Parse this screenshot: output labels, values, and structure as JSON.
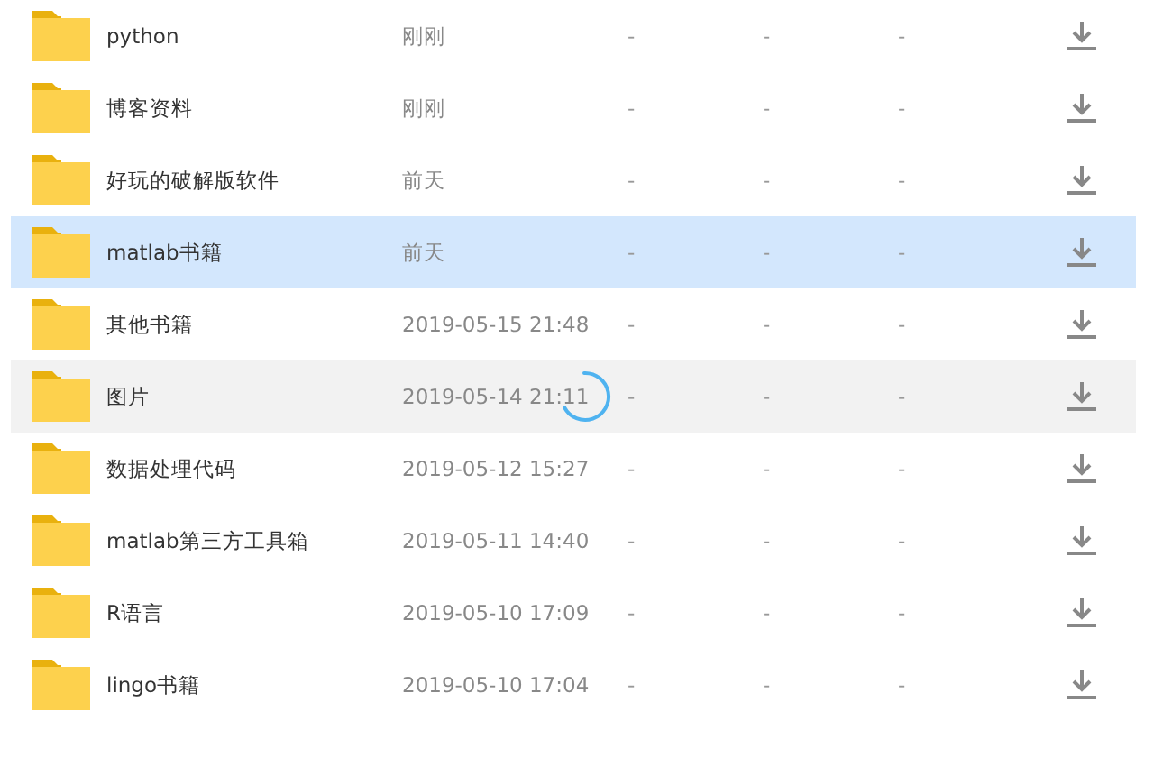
{
  "files": [
    {
      "name": "python",
      "time": "刚刚",
      "column_3": "-",
      "column_4": "-",
      "column_5": "-",
      "selected": false,
      "hovered": false,
      "loading": false
    },
    {
      "name": "博客资料",
      "time": "刚刚",
      "column_3": "-",
      "column_4": "-",
      "column_5": "-",
      "selected": false,
      "hovered": false,
      "loading": false
    },
    {
      "name": "好玩的破解版软件",
      "time": "前天",
      "column_3": "-",
      "column_4": "-",
      "column_5": "-",
      "selected": false,
      "hovered": false,
      "loading": false
    },
    {
      "name": "matlab书籍",
      "time": "前天",
      "column_3": "-",
      "column_4": "-",
      "column_5": "-",
      "selected": true,
      "hovered": false,
      "loading": false
    },
    {
      "name": "其他书籍",
      "time": "2019-05-15 21:48",
      "column_3": "-",
      "column_4": "-",
      "column_5": "-",
      "selected": false,
      "hovered": false,
      "loading": false
    },
    {
      "name": "图片",
      "time": "2019-05-14 21:11",
      "column_3": "-",
      "column_4": "-",
      "column_5": "-",
      "selected": false,
      "hovered": true,
      "loading": true
    },
    {
      "name": "数据处理代码",
      "time": "2019-05-12 15:27",
      "column_3": "-",
      "column_4": "-",
      "column_5": "-",
      "selected": false,
      "hovered": false,
      "loading": false
    },
    {
      "name": "matlab第三方工具箱",
      "time": "2019-05-11 14:40",
      "column_3": "-",
      "column_4": "-",
      "column_5": "-",
      "selected": false,
      "hovered": false,
      "loading": false
    },
    {
      "name": "R语言",
      "time": "2019-05-10 17:09",
      "column_3": "-",
      "column_4": "-",
      "column_5": "-",
      "selected": false,
      "hovered": false,
      "loading": false
    },
    {
      "name": "lingo书籍",
      "time": "2019-05-10 17:04",
      "column_3": "-",
      "column_4": "-",
      "column_5": "-",
      "selected": false,
      "hovered": false,
      "loading": false
    }
  ]
}
